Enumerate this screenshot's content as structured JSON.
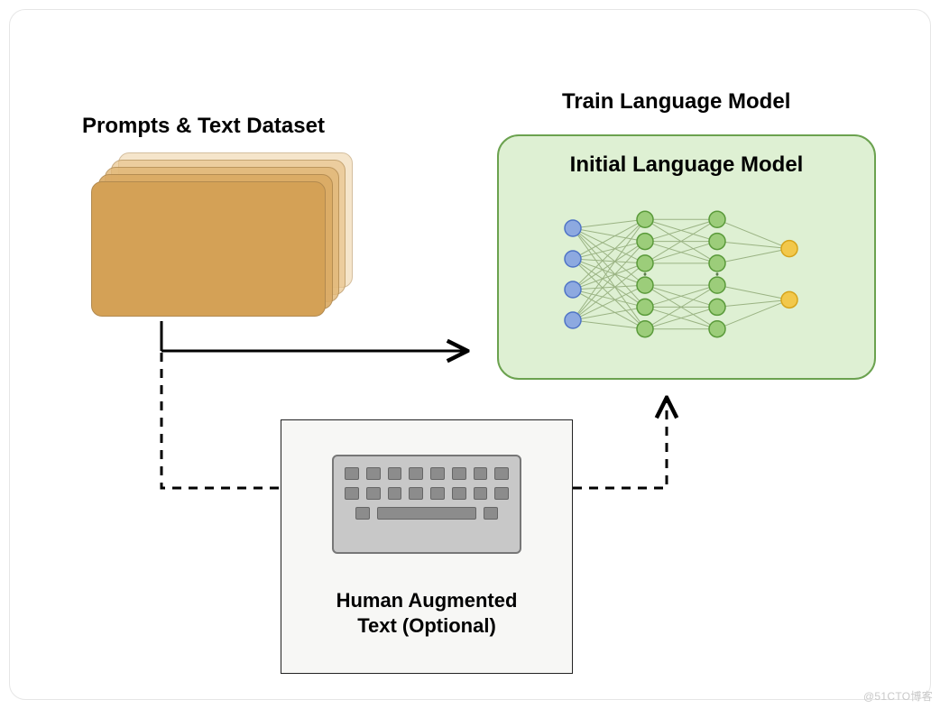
{
  "labels": {
    "dataset": "Prompts & Text Dataset",
    "train": "Train Language Model",
    "model_title": "Initial Language Model",
    "human_line1": "Human Augmented",
    "human_line2": "Text (Optional)"
  },
  "watermark": "@51CTO博客",
  "colors": {
    "model_bg": "#def0d3",
    "model_border": "#6ba24f",
    "nn_input": "#8da9e0",
    "nn_input_stroke": "#4f74c6",
    "nn_hidden": "#9ccd7a",
    "nn_hidden_stroke": "#5a9a3a",
    "nn_output": "#f2c84b",
    "nn_output_stroke": "#d6a41b",
    "nn_edge": "#9ab383"
  },
  "diagram": {
    "nodes": [
      {
        "id": "dataset",
        "label_key": "labels.dataset"
      },
      {
        "id": "human",
        "label_key": "labels.human_line1"
      },
      {
        "id": "model",
        "label_key": "labels.model_title"
      }
    ],
    "edges": [
      {
        "from": "dataset",
        "to": "model",
        "style": "solid",
        "optional": false
      },
      {
        "from": "dataset",
        "to": "human",
        "style": "dashed",
        "optional": true
      },
      {
        "from": "human",
        "to": "model",
        "style": "dashed",
        "optional": true
      }
    ],
    "nn": {
      "layers": [
        {
          "role": "input",
          "count": 4
        },
        {
          "role": "hidden",
          "count": 6,
          "ellipsis": true
        },
        {
          "role": "hidden",
          "count": 6,
          "ellipsis": true
        },
        {
          "role": "output",
          "count": 2
        }
      ]
    }
  }
}
